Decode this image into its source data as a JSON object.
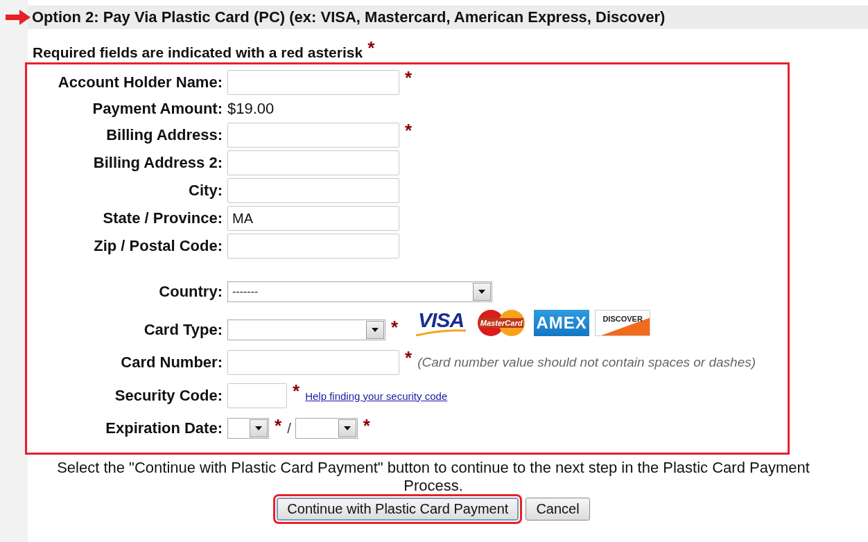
{
  "header": {
    "title": "Option 2: Pay Via Plastic Card (PC) (ex: VISA, Mastercard, American Express, Discover)"
  },
  "required_note": "Required fields are indicated with a red asterisk",
  "required_mark": "*",
  "fields": [
    {
      "kind": "text",
      "label": "Account Holder Name:",
      "required": true
    },
    {
      "kind": "static",
      "label": "Payment Amount:",
      "value": "$19.00"
    },
    {
      "kind": "text",
      "label": "Billing Address:",
      "required": true
    },
    {
      "kind": "text",
      "label": "Billing Address 2:"
    },
    {
      "kind": "text",
      "label": "City:"
    },
    {
      "kind": "text",
      "label": "State / Province:",
      "value": "MA"
    },
    {
      "kind": "text",
      "label": "Zip / Postal Code:"
    },
    {
      "kind": "select",
      "label": "Country:",
      "value": "-------"
    },
    {
      "kind": "cardtype",
      "label": "Card Type:",
      "required": true,
      "cards": [
        {
          "kind": "visa",
          "label": "VISA"
        },
        {
          "kind": "mastercard",
          "label": "MasterCard"
        },
        {
          "kind": "amex",
          "label": "AMEX"
        },
        {
          "kind": "discover",
          "label": "DISCOVER"
        }
      ]
    },
    {
      "kind": "cardnumber",
      "label": "Card Number:",
      "required": true,
      "hint": "(Card number value should not contain spaces or dashes)"
    },
    {
      "kind": "security",
      "label": "Security Code:",
      "required": true,
      "link": "Help finding your security code"
    },
    {
      "kind": "expiration",
      "label": "Expiration Date:",
      "separator": "/",
      "parts": [
        {
          "required": true
        },
        {
          "required": true
        }
      ]
    }
  ],
  "instruction": "Select the \"Continue with Plastic Card Payment\" button to continue to the next step in the Plastic Card Payment Process.",
  "buttons": [
    {
      "label": "Continue with Plastic Card Payment",
      "highlighted": true
    },
    {
      "label": "Cancel",
      "highlighted": false
    }
  ]
}
